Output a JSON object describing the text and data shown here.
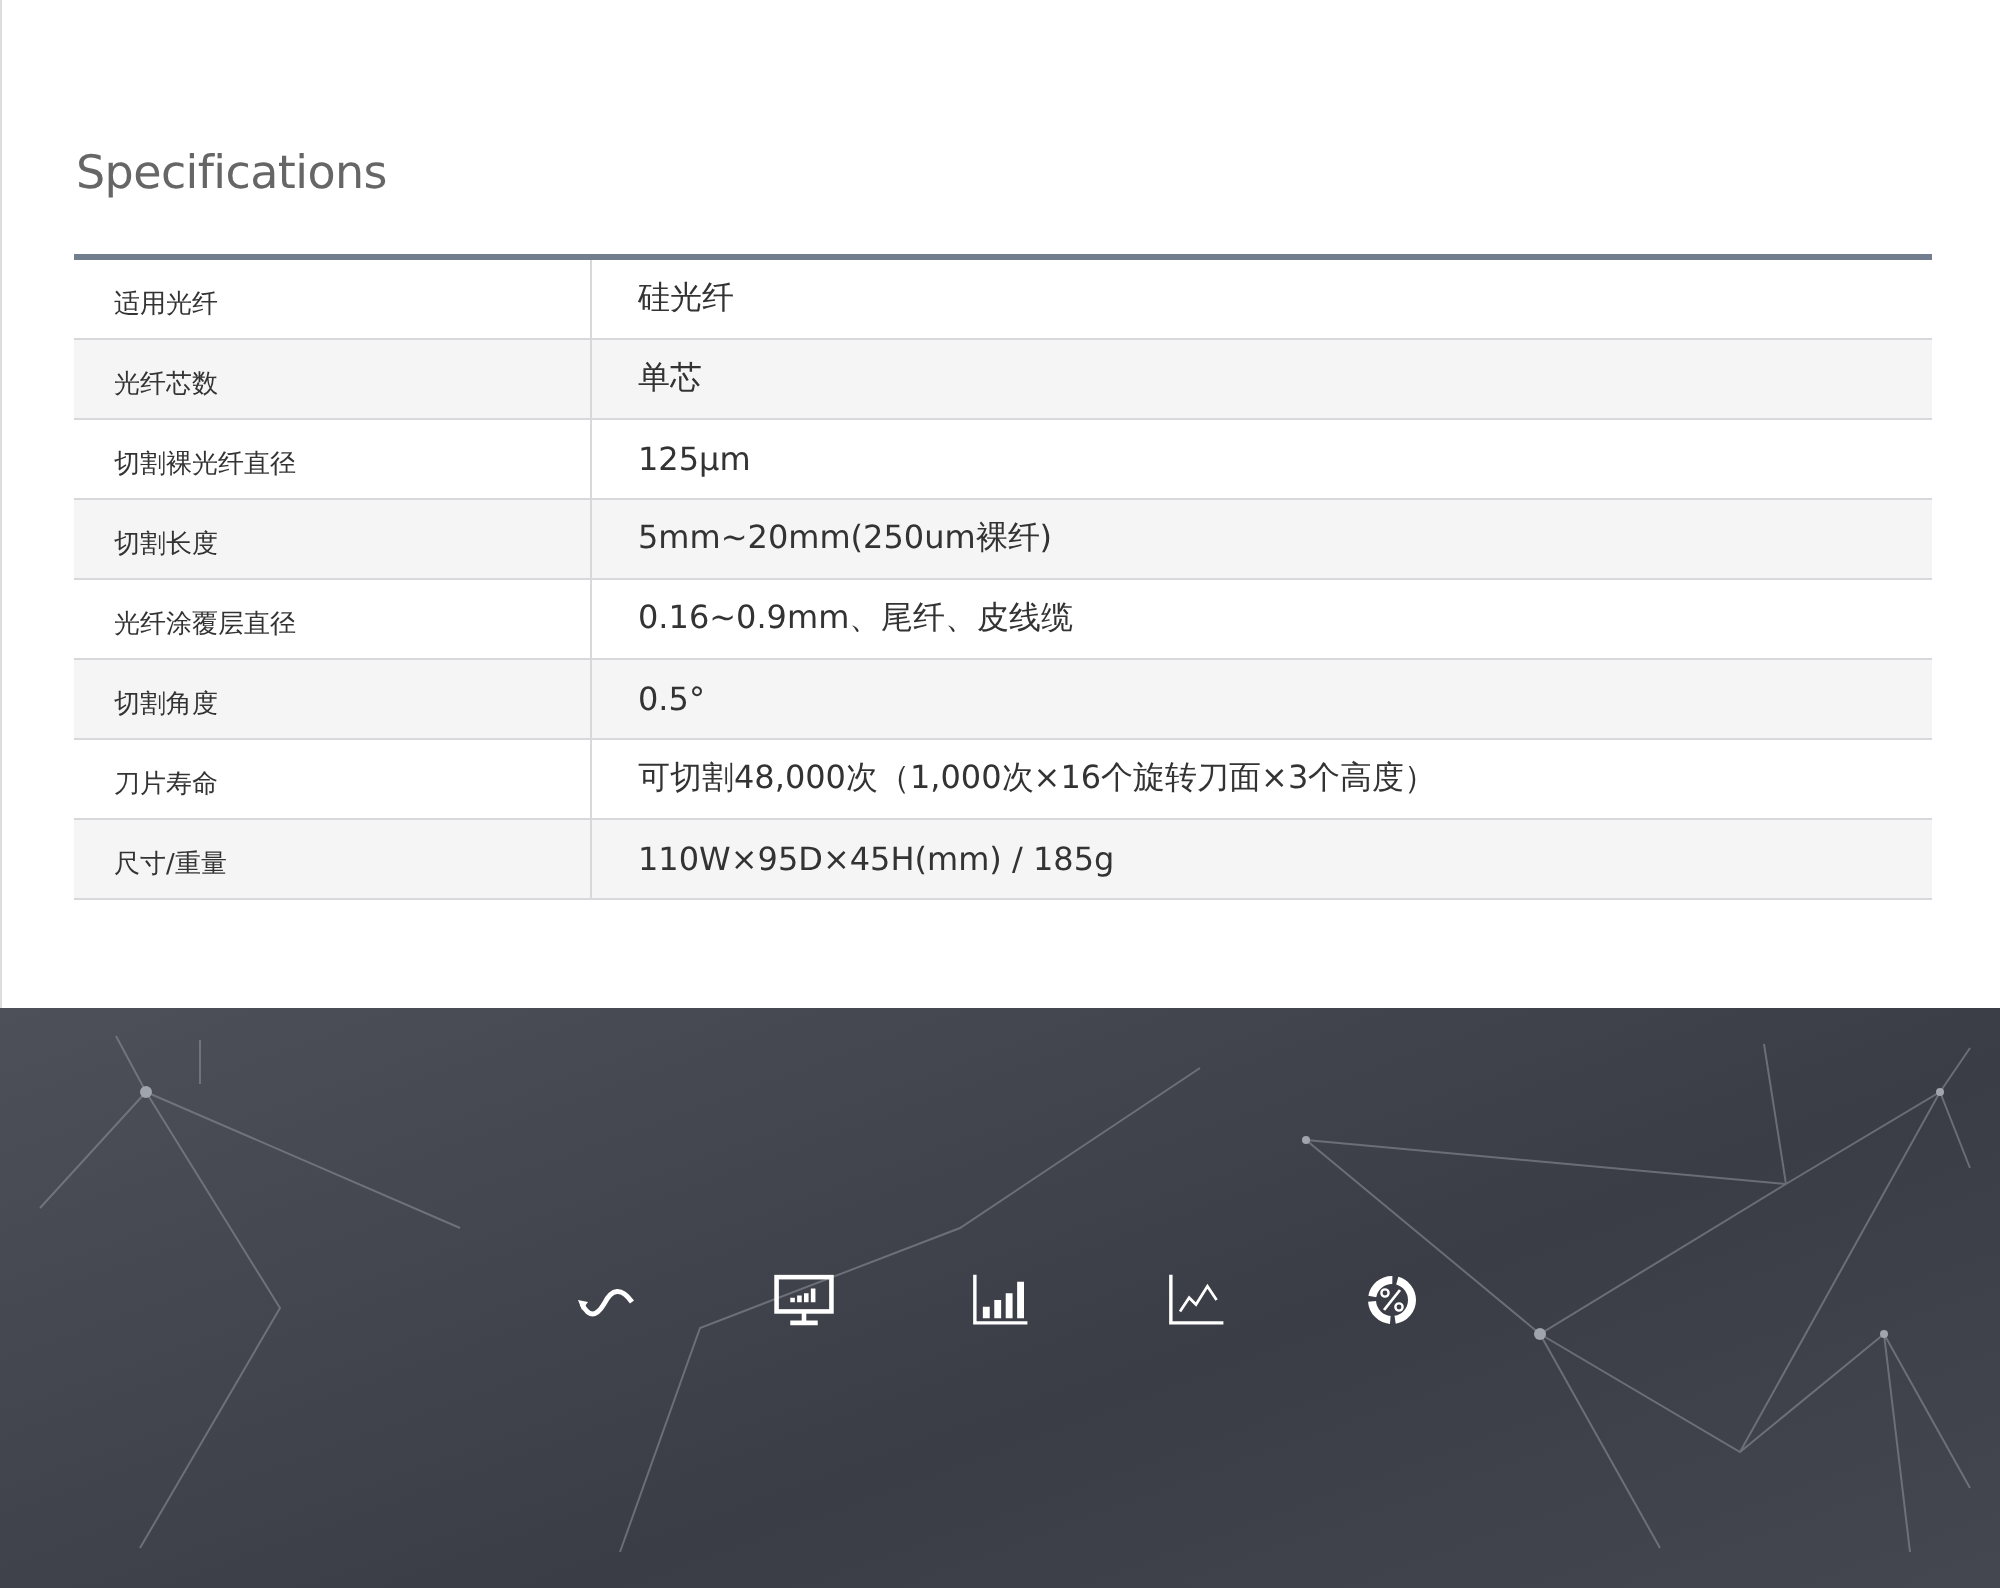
{
  "section_title": "Specifications",
  "specs": [
    {
      "label": "适用光纤",
      "value": "硅光纤"
    },
    {
      "label": "光纤芯数",
      "value": "单芯"
    },
    {
      "label": "切割裸光纤直径",
      "value": "125μm"
    },
    {
      "label": "切割长度",
      "value": "5mm~20mm(250um裸纤)"
    },
    {
      "label": "光纤涂覆层直径",
      "value": "0.16~0.9mm、尾纤、皮线缆"
    },
    {
      "label": "切割角度",
      "value": "0.5°"
    },
    {
      "label": "刀片寿命",
      "value": "可切割48,000次（1,000次×16个旋转刀面×3个高度）"
    },
    {
      "label": "尺寸/重量",
      "value": "110W×95D×45H(mm) / 185g"
    }
  ],
  "feature_icons": [
    {
      "kind": "wave"
    },
    {
      "kind": "monitor"
    },
    {
      "kind": "bars"
    },
    {
      "kind": "line"
    },
    {
      "kind": "percent"
    }
  ]
}
